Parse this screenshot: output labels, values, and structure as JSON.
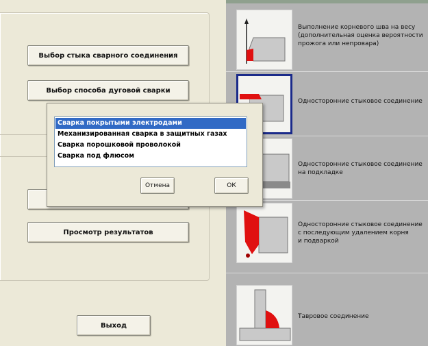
{
  "left": {
    "buttons": {
      "joint_type": "Выбор стыка сварного соединения",
      "arc_method": "Выбор способа дуговой сварки",
      "view_results": "Просмотр результатов",
      "exit": "Выход"
    }
  },
  "dialog": {
    "options": [
      "Сварка покрытыми электродами",
      "Механизированная сварка в защитных газах",
      "Сварка порошковой проволокой",
      "Сварка под флюсом"
    ],
    "selected_index": 0,
    "cancel_label": "Отмена",
    "ok_label": "ОК"
  },
  "joints": [
    {
      "lines": [
        "Выполнение корневого шва на весу",
        "(дополнительная оценка вероятности",
        "прожога или непровара)"
      ],
      "selected": false
    },
    {
      "lines": [
        "Односторонние стыковое соединение"
      ],
      "selected": true
    },
    {
      "lines": [
        "Односторонние стыковое соединение",
        "на подкладке"
      ],
      "selected": false
    },
    {
      "lines": [
        "Односторонние стыковое соединение",
        "с последующим удалением корня",
        "и подваркой"
      ],
      "selected": false
    },
    {
      "lines": [
        "Тавровое соединение"
      ],
      "selected": false
    }
  ],
  "colors": {
    "selection": "#316ac5",
    "weld": "#e01010",
    "selected_frame": "#1a2a8a"
  }
}
